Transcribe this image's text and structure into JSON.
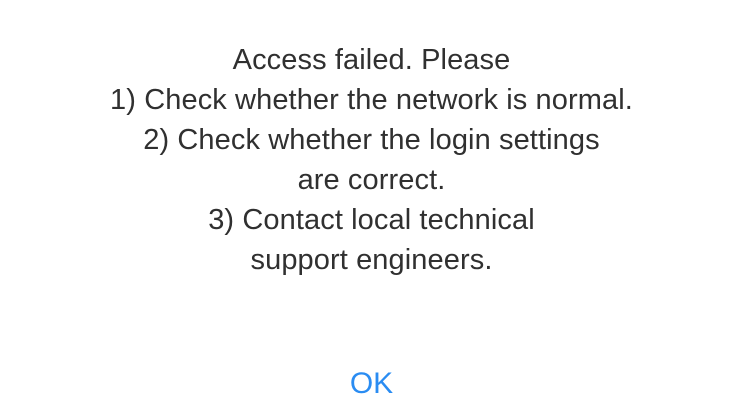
{
  "dialog": {
    "message_lines": [
      "Access failed. Please",
      "1) Check whether the network is normal.",
      "2) Check whether the login settings",
      "are correct.",
      "3) Contact local technical",
      "support engineers."
    ],
    "ok_label": "OK",
    "colors": {
      "text": "#303030",
      "accent": "#2a8cf2",
      "background": "#ffffff"
    }
  }
}
